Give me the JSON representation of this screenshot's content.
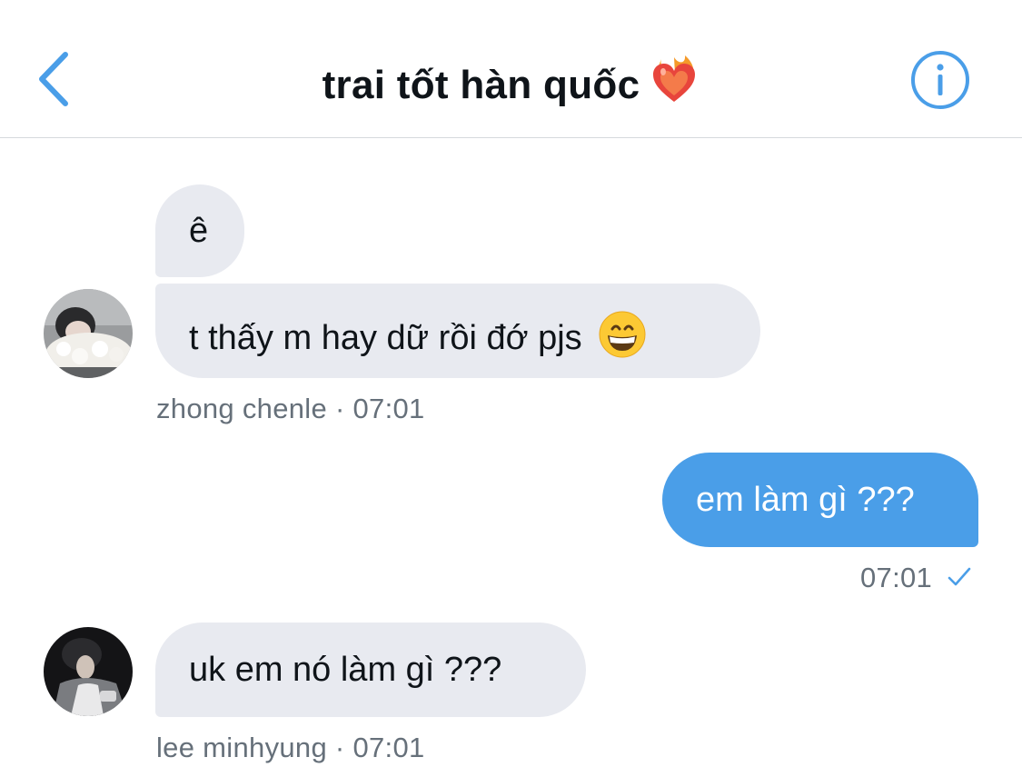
{
  "header": {
    "title": "trai tốt hàn quốc",
    "title_emoji": "heart-on-fire",
    "back_icon": "chevron-left-icon",
    "info_icon": "info-icon"
  },
  "colors": {
    "accent": "#4a9ee8",
    "incoming_bubble": "#e8eaf0",
    "text": "#0f1419",
    "meta_text": "#66707a"
  },
  "messages": [
    {
      "direction": "incoming",
      "texts": [
        "ê",
        "t thấy m hay dữ rồi đớ pjs"
      ],
      "emoji": "grinning-face",
      "sender": "zhong chenle",
      "time": "07:01"
    },
    {
      "direction": "outgoing",
      "text": "em làm gì ???",
      "time": "07:01",
      "status": "sent"
    },
    {
      "direction": "incoming",
      "texts": [
        "uk em nó làm gì ???"
      ],
      "sender": "lee minhyung",
      "time": "07:01"
    }
  ]
}
